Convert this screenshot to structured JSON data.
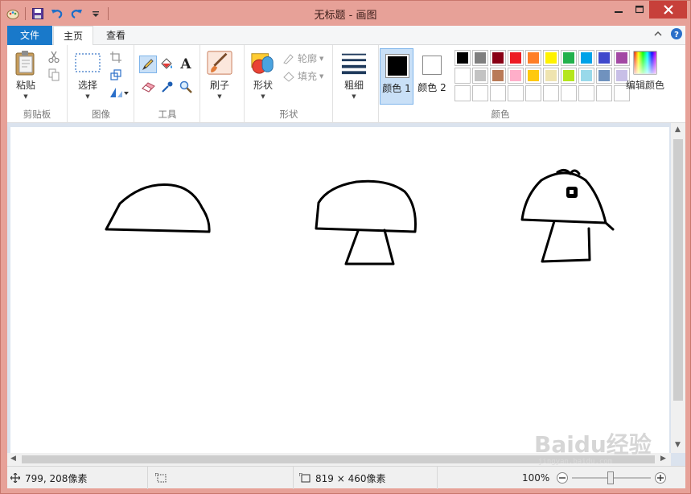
{
  "window": {
    "title": "无标题 - 画图"
  },
  "tabs": {
    "file": "文件",
    "home": "主页",
    "view": "查看"
  },
  "ribbon": {
    "clipboard": {
      "label": "剪贴板",
      "paste": "粘贴"
    },
    "image": {
      "label": "图像",
      "select": "选择"
    },
    "tools": {
      "label": "工具",
      "text_tool": "A"
    },
    "brushes": {
      "brush": "刷子"
    },
    "shapes": {
      "label": "形状",
      "shapes_btn": "形状",
      "outline": "轮廓",
      "fill": "填充"
    },
    "size": {
      "label": "粗细"
    },
    "colors": {
      "label": "颜色",
      "color1_label": "颜色 1",
      "color2_label": "颜色 2",
      "edit_colors": "编辑颜色",
      "color1_value": "#000000",
      "color2_value": "#ffffff",
      "palette_row1": [
        "#000000",
        "#7f7f7f",
        "#880015",
        "#ed1c24",
        "#ff7f27",
        "#fff200",
        "#22b14c",
        "#00a2e8",
        "#3f48cc",
        "#a349a4"
      ],
      "palette_row2": [
        "#ffffff",
        "#c3c3c3",
        "#b97a57",
        "#ffaec9",
        "#ffc90e",
        "#efe4b0",
        "#b5e61d",
        "#99d9ea",
        "#7092be",
        "#c8bfe7"
      ],
      "palette_row3": [
        "",
        "",
        "",
        "",
        "",
        "",
        "",
        "",
        "",
        ""
      ]
    }
  },
  "status": {
    "cursor_position": "799, 208像素",
    "canvas_size": "819 × 460像素",
    "zoom": "100%"
  },
  "watermark": {
    "brand": "Baidu经验",
    "url": "jingyan.baidu.com"
  },
  "colors": {
    "title_bar": "#e7a198",
    "file_tab": "#1979ca",
    "close_button": "#c7403a",
    "work_area": "#dbe3ee"
  }
}
